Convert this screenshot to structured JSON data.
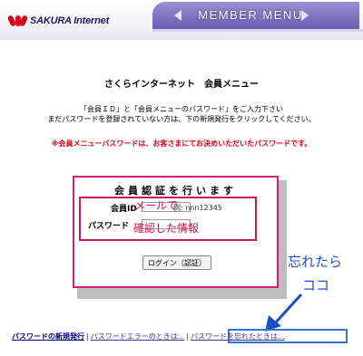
{
  "header": {
    "logo_text": "SAKURA Internet",
    "menu_label": "MEMBER MENU"
  },
  "page": {
    "title": "さくらインターネット　会員メニュー",
    "instruction_line1": "「会員ＩＤ」と「会員メニューのパスワード」をご入力下さい",
    "instruction_line2": "まだパスワードを登録されていない方は、下の新規発行をクリックしてください。",
    "warning": "※会員メニューパスワードは、お客さまにてお決めいただいたパスワードです。"
  },
  "auth": {
    "heading": "会員認証を行います",
    "id_label": "会員ID",
    "id_example": "例: nnn12345",
    "password_label": "パスワード",
    "login_button": "ログイン（認証）"
  },
  "annotations": {
    "via_mail": "メールで",
    "confirmed_info": "確認した情報",
    "forgot_line1": "忘れたら",
    "forgot_line2": "ココ"
  },
  "links": {
    "new_password": "パスワードの新規発行",
    "separator": "|",
    "password_error": "パスワードエラーのときは...",
    "forgot_password": "パスワードを忘れたときは..."
  }
}
